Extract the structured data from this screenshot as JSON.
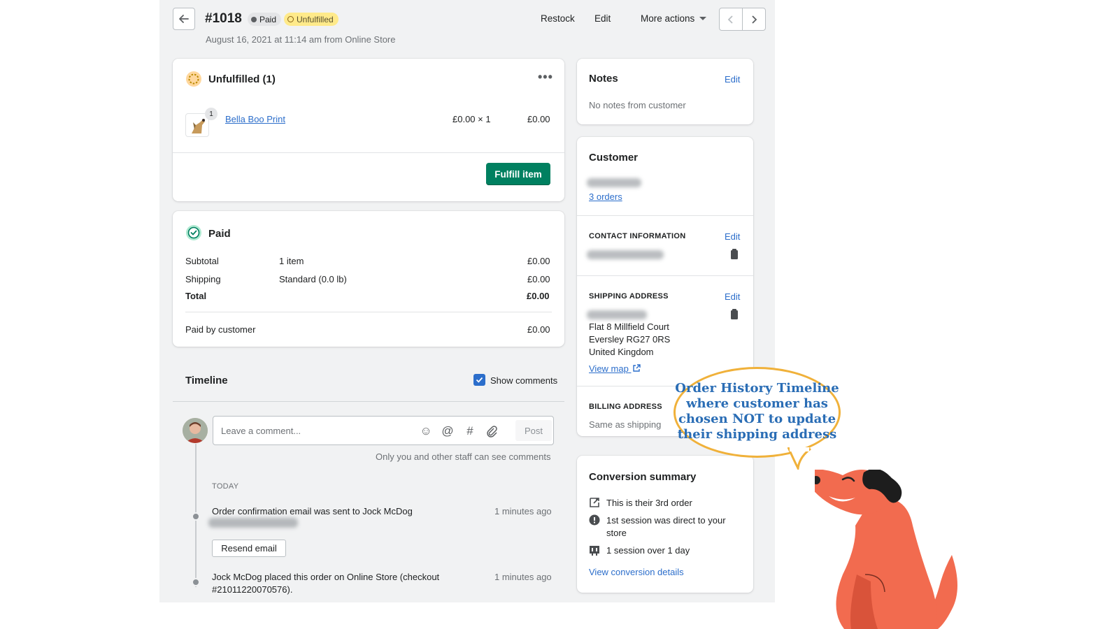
{
  "header": {
    "order_number": "#1018",
    "badge_paid": "Paid",
    "badge_unfulfilled": "Unfulfilled",
    "date_line": "August 16, 2021 at 11:14 am from Online Store",
    "restock": "Restock",
    "edit": "Edit",
    "more_actions": "More actions"
  },
  "unfulfilled_card": {
    "title": "Unfulfilled (1)",
    "item_name": "Bella Boo Print",
    "item_qty_badge": "1",
    "item_price": "£0.00 × 1",
    "item_total": "£0.00",
    "fulfill_button": "Fulfill item"
  },
  "paid_card": {
    "title": "Paid",
    "rows": [
      {
        "label": "Subtotal",
        "detail": "1 item",
        "amount": "£0.00"
      },
      {
        "label": "Shipping",
        "detail": "Standard (0.0 lb)",
        "amount": "£0.00"
      },
      {
        "label": "Total",
        "detail": "",
        "amount": "£0.00"
      }
    ],
    "paid_by_label": "Paid by customer",
    "paid_by_amount": "£0.00"
  },
  "timeline": {
    "title": "Timeline",
    "show_comments": "Show comments",
    "comment_placeholder": "Leave a comment...",
    "post_button": "Post",
    "staff_note": "Only you and other staff can see comments",
    "day_label": "TODAY",
    "events": [
      {
        "text": "Order confirmation email was sent to Jock McDog",
        "time": "1 minutes ago"
      },
      {
        "text_line1": "Jock McDog placed this order on Online Store (checkout",
        "text_line2": "#21011220070576).",
        "time": "1 minutes ago"
      }
    ],
    "resend_button": "Resend email"
  },
  "notes_card": {
    "title": "Notes",
    "edit": "Edit",
    "body": "No notes from customer"
  },
  "customer_card": {
    "title": "Customer",
    "orders_link": "3 orders",
    "contact_heading": "CONTACT INFORMATION",
    "contact_edit": "Edit",
    "shipping_heading": "SHIPPING ADDRESS",
    "shipping_edit": "Edit",
    "address_line1": "Flat 8 Millfield Court",
    "address_line2": "Eversley RG27 0RS",
    "address_line3": "United Kingdom",
    "view_map": "View map",
    "billing_heading": "BILLING ADDRESS",
    "billing_body": "Same as shipping"
  },
  "conversion_card": {
    "title": "Conversion summary",
    "item1": "This is their 3rd order",
    "item2_line1": "1st session was direct to your",
    "item2_line2": "store",
    "item3": "1 session over 1 day",
    "link": "View conversion details"
  },
  "callout": {
    "line1": "Order History Timeline",
    "line2": "where customer has",
    "line3": "chosen NOT to update",
    "line4": "their shipping address"
  },
  "colors": {
    "primary_green": "#008060",
    "link_blue": "#2c6ecb",
    "badge_yellow": "#ffea8a",
    "dog_orange": "#f26b4f",
    "bubble_border": "#f0b13a"
  }
}
